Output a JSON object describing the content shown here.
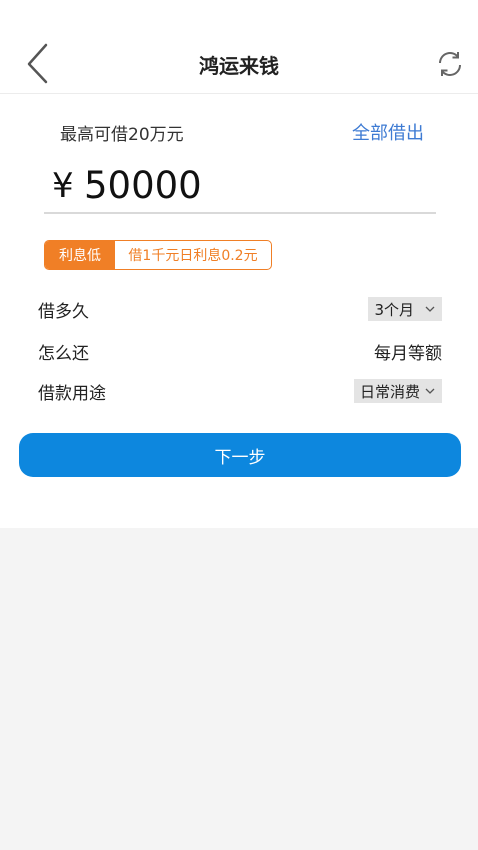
{
  "header": {
    "title": "鸿运来钱"
  },
  "loan": {
    "max_label": "最高可借20万元",
    "borrow_all": "全部借出",
    "currency": "¥",
    "amount": "50000",
    "rate_tag": "利息低",
    "rate_desc": "借1千元日利息0.2元"
  },
  "form": {
    "duration_label": "借多久",
    "duration_value": "3个月",
    "repay_label": "怎么还",
    "repay_value": "每月等额",
    "purpose_label": "借款用途",
    "purpose_value": "日常消费"
  },
  "actions": {
    "next_label": "下一步"
  },
  "colors": {
    "accent_blue": "#0d87de",
    "link_blue": "#3e7bd3",
    "orange": "#f07f26"
  },
  "icons": [
    "chevron-left-icon",
    "refresh-icon",
    "chevron-down-icon"
  ]
}
